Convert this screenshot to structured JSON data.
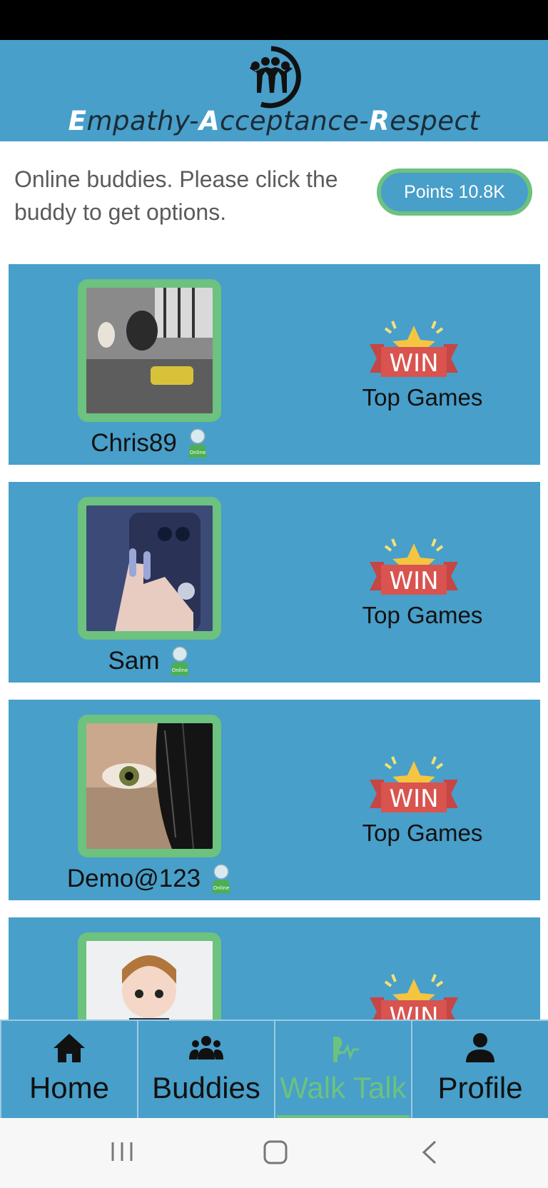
{
  "header": {
    "brand": {
      "e1": "E",
      "r1": "mpathy-",
      "e2": "A",
      "r2": "cceptance-",
      "e3": "R",
      "r3": "espect"
    },
    "colors": {
      "primary": "#489fc9",
      "accent": "#6cc27e"
    }
  },
  "intro_text": "Online  buddies. Please click the buddy to get options.",
  "points_label": "Points 10.8K",
  "buddies": [
    {
      "name": "Chris89",
      "status": "Online",
      "games_label": "Top Games",
      "win_text": "WIN"
    },
    {
      "name": "Sam",
      "status": "Online",
      "games_label": "Top Games",
      "win_text": "WIN"
    },
    {
      "name": "Demo@123",
      "status": "Online",
      "games_label": "Top Games",
      "win_text": "WIN"
    },
    {
      "name": "",
      "status": "",
      "games_label": "",
      "win_text": "WIN"
    }
  ],
  "nav": {
    "items": [
      {
        "label": "Home",
        "icon": "home-icon"
      },
      {
        "label": "Buddies",
        "icon": "group-icon"
      },
      {
        "label": "Walk Talk",
        "icon": "walk-talk-icon",
        "active": true
      },
      {
        "label": "Profile",
        "icon": "profile-icon"
      }
    ]
  }
}
